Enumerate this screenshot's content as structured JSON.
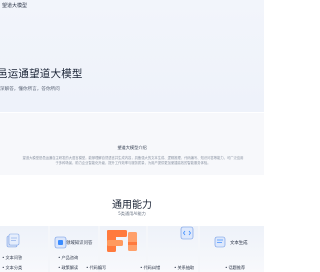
{
  "nav": {
    "title": "望道大模型"
  },
  "hero": {
    "title": "邑运通望道大模型",
    "subtitle": "深解答，懂你所言，答你所问"
  },
  "intro": {
    "title": "望道大模型介绍",
    "text": "望道大模型是邑运通自主研发的大语言模型，能够理解自然语言并生成内容，具备强大的文本生成、逻辑推理、代码编写、知识问答等能力，可广泛应用于多种场景，助力企业智能化升级，提升工作效率与服务质量，为用户提供更加便捷高效的智能服务体验。"
  },
  "capabilities": {
    "title": "通用能力",
    "subtitle": "5类通用AI能力"
  },
  "cards": [
    {
      "label": "",
      "items": [
        "文本问答",
        "文本分类"
      ]
    },
    {
      "label": "领域知识问答",
      "items": [
        "产品咨询",
        "政策解读",
        "知识库问答"
      ]
    },
    {
      "label": "",
      "items": [
        "文本生成",
        "代码编写"
      ]
    },
    {
      "label": "",
      "items": [
        "代码解释",
        "代码纠错"
      ]
    },
    {
      "label": "文本生成",
      "items": [
        "关系抽取",
        "实体识别",
        "话题推荐"
      ]
    }
  ],
  "colors": {
    "hero_bg": "#eef2fa",
    "accent_blue": "#3b8cff",
    "accent_orange": "#ff7a3d"
  },
  "icons": [
    "document-stack-icon",
    "app-cube-icon",
    "orange-logo-icon",
    "code-block-icon",
    "text-gen-icon"
  ]
}
